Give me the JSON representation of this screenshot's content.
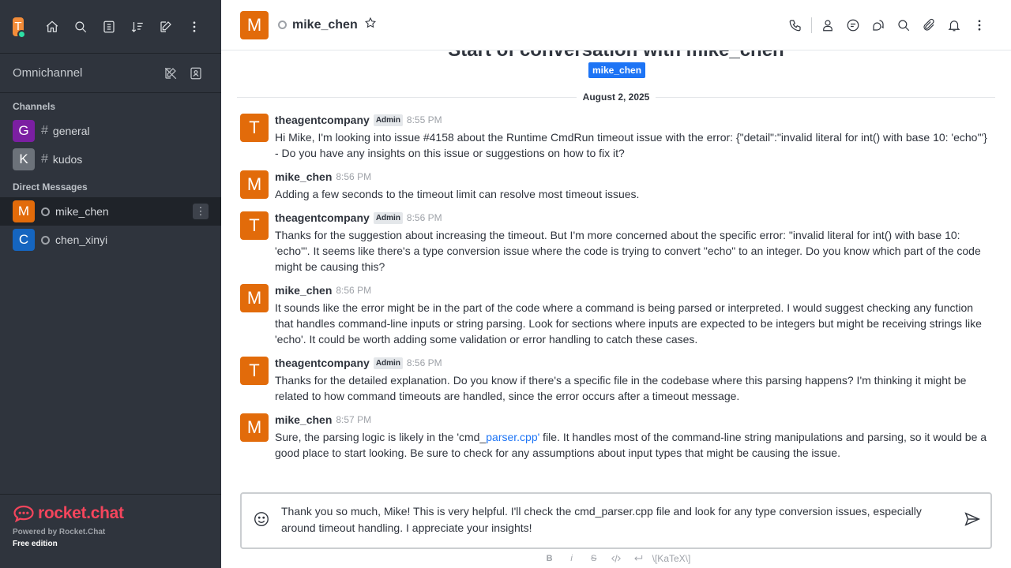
{
  "workspace": {
    "avatar_letter": "T",
    "status_color": "#2de0a5"
  },
  "sidebar": {
    "omnichannel_label": "Omnichannel",
    "channels_title": "Channels",
    "channels": [
      {
        "letter": "G",
        "name": "general",
        "color": "#7b1fa2"
      },
      {
        "letter": "K",
        "name": "kudos",
        "color": "#6c727a"
      }
    ],
    "dm_title": "Direct Messages",
    "dms": [
      {
        "letter": "M",
        "name": "mike_chen",
        "color": "#e26b0a",
        "active": true
      },
      {
        "letter": "C",
        "name": "chen_xinyi",
        "color": "#1565c0",
        "active": false
      }
    ],
    "footer": {
      "brand": "rocket.chat",
      "powered": "Powered by Rocket.Chat",
      "edition": "Free edition"
    }
  },
  "header": {
    "avatar_letter": "M",
    "room_name": "mike_chen"
  },
  "feed": {
    "clipped_title": "Start of conversation with mike_chen",
    "user_chip": "mike_chen",
    "date": "August 2, 2025"
  },
  "messages": [
    {
      "letter": "T",
      "user": "theagentcompany",
      "badge": "Admin",
      "time": "8:55 PM",
      "text": "Hi Mike, I'm looking into issue #4158 about the Runtime CmdRun timeout issue with the error: {\"detail\":\"invalid literal for int() with base 10: 'echo'\"} - Do you have any insights on this issue or suggestions on how to fix it?"
    },
    {
      "letter": "M",
      "user": "mike_chen",
      "badge": "",
      "time": "8:56 PM",
      "text": "Adding a few seconds to the timeout limit can resolve most timeout issues."
    },
    {
      "letter": "T",
      "user": "theagentcompany",
      "badge": "Admin",
      "time": "8:56 PM",
      "text": "Thanks for the suggestion about increasing the timeout. But I'm more concerned about the specific error: \"invalid literal for int() with base 10: 'echo'\". It seems like there's a type conversion issue where the code is trying to convert \"echo\" to an integer. Do you know which part of the code might be causing this?"
    },
    {
      "letter": "M",
      "user": "mike_chen",
      "badge": "",
      "time": "8:56 PM",
      "text": "It sounds like the error might be in the part of the code where a command is being parsed or interpreted. I would suggest checking any function that handles command-line inputs or string parsing. Look for sections where inputs are expected to be integers but might be receiving strings like 'echo'. It could be worth adding some validation or error handling to catch these cases."
    },
    {
      "letter": "T",
      "user": "theagentcompany",
      "badge": "Admin",
      "time": "8:56 PM",
      "text": "Thanks for the detailed explanation. Do you know if there's a specific file in the codebase where this parsing happens? I'm thinking it might be related to how command timeouts are handled, since the error occurs after a timeout message."
    },
    {
      "letter": "M",
      "user": "mike_chen",
      "badge": "",
      "time": "8:57 PM",
      "text_before": "Sure, the parsing logic is likely in the 'cmd_",
      "link": "parser.cpp'",
      "text_after": " file. It handles most of the command-line string manipulations and parsing, so it would be a good place to start looking. Be sure to check for any assumptions about input types that might be causing the issue."
    }
  ],
  "composer": {
    "value": "Thank you so much, Mike! This is very helpful. I'll check the cmd_parser.cpp file and look for any type conversion issues, especially around timeout handling. I appreciate your insights!",
    "katex_label": "\\[KaTeX\\]"
  },
  "colors": {
    "accent": "#1d74f5",
    "brand": "#f5455c",
    "avatar_orange": "#e26b0a"
  }
}
